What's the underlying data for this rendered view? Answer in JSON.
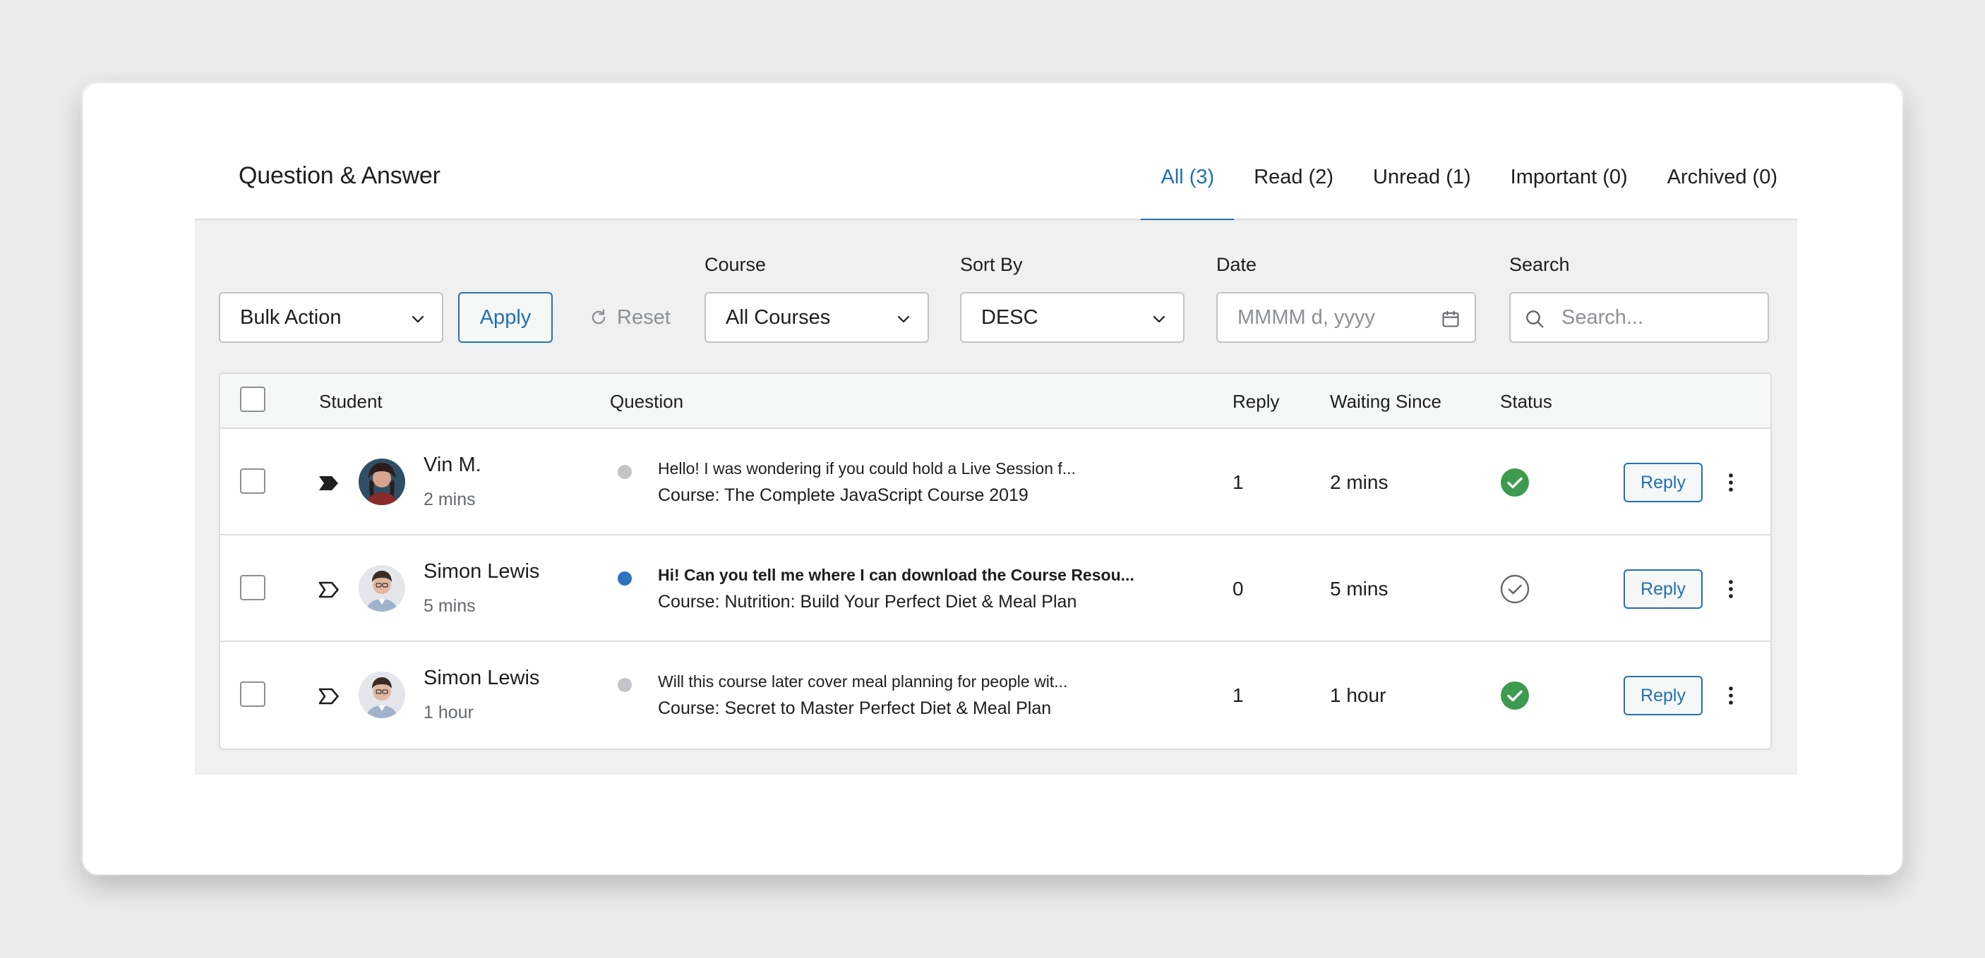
{
  "page": {
    "title": "Question & Answer"
  },
  "tabs": [
    {
      "label": "All (3)",
      "active": true
    },
    {
      "label": "Read (2)",
      "active": false
    },
    {
      "label": "Unread (1)",
      "active": false
    },
    {
      "label": "Important (0)",
      "active": false
    },
    {
      "label": "Archived (0)",
      "active": false
    }
  ],
  "filters": {
    "bulk_action": {
      "value": "Bulk Action"
    },
    "apply_label": "Apply",
    "reset_label": "Reset",
    "course": {
      "label": "Course",
      "value": "All Courses"
    },
    "sort_by": {
      "label": "Sort By",
      "value": "DESC"
    },
    "date": {
      "label": "Date",
      "placeholder": "MMMM d, yyyy"
    },
    "search": {
      "label": "Search",
      "placeholder": "Search..."
    }
  },
  "table": {
    "columns": {
      "student": "Student",
      "question": "Question",
      "reply": "Reply",
      "waiting_since": "Waiting Since",
      "status": "Status"
    },
    "rows": [
      {
        "student_name": "Vin M.",
        "student_time": "2 mins",
        "important": true,
        "unread": false,
        "question": "Hello! I was wondering if you could hold a Live Session f...",
        "course": "Course: The Complete JavaScript Course 2019",
        "reply_count": "1",
        "waiting_since": "2 mins",
        "status": "answered",
        "reply_label": "Reply"
      },
      {
        "student_name": "Simon Lewis",
        "student_time": "5 mins",
        "important": false,
        "unread": true,
        "question": "Hi! Can you tell me where I can download the Course Resou...",
        "course": "Course: Nutrition: Build Your Perfect Diet & Meal Plan",
        "reply_count": "0",
        "waiting_since": "5 mins",
        "status": "pending",
        "reply_label": "Reply"
      },
      {
        "student_name": "Simon Lewis",
        "student_time": "1 hour",
        "important": false,
        "unread": false,
        "question": "Will this course later cover meal planning for people wit...",
        "course": "Course: Secret to Master Perfect Diet & Meal Plan",
        "reply_count": "1",
        "waiting_since": "1 hour",
        "status": "answered",
        "reply_label": "Reply"
      }
    ]
  },
  "colors": {
    "accent": "#2271b1",
    "status_answered": "#3e9a4e",
    "unread_dot": "#2c72be",
    "read_dot": "#c3c4c7"
  },
  "icons": {
    "important_tag": "tag-filled-icon",
    "normal_tag": "tag-outline-icon",
    "answered": "check-circle-filled-icon",
    "pending": "check-circle-outline-icon"
  }
}
